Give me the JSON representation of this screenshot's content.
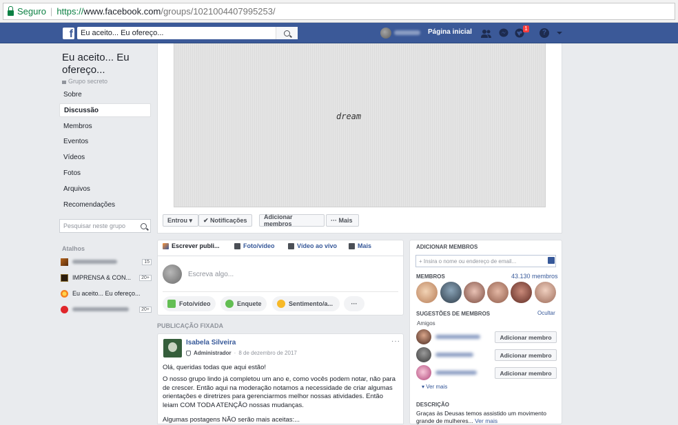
{
  "browser": {
    "secure_label": "Seguro",
    "url_prefix": "https://",
    "url_domain": "www.facebook.com",
    "url_path": "/groups/1021004407995253/"
  },
  "topbar": {
    "logo": "f",
    "search_value": "Eu aceito... Eu ofereço...",
    "home_label": "Página inicial",
    "notification_count": "1",
    "help": "?"
  },
  "sidebar": {
    "group_name": "Eu aceito... Eu ofereço...",
    "group_type": "Grupo secreto",
    "items": [
      "Sobre",
      "Discussão",
      "Membros",
      "Eventos",
      "Vídeos",
      "Fotos",
      "Arquivos",
      "Recomendações"
    ],
    "active_index": 1,
    "search_placeholder": "Pesquisar neste grupo",
    "shortcuts_title": "Atalhos",
    "shortcuts": [
      {
        "label": "",
        "count": "15"
      },
      {
        "label": "IMPRENSA & CON...",
        "count": "20+"
      },
      {
        "label": "Eu aceito... Eu ofereço...",
        "count": ""
      },
      {
        "label": "",
        "count": "20+"
      }
    ]
  },
  "cover": {
    "text": "dream",
    "buttons": [
      "Entrou ▾",
      "✔ Notificações",
      "Adicionar membros",
      "··· Mais"
    ]
  },
  "composer": {
    "tabs": [
      "Escrever publi...",
      "Foto/vídeo",
      "Vídeo ao vivo",
      "Mais"
    ],
    "placeholder": "Escreva algo...",
    "actions": [
      "Foto/vídeo",
      "Enquete",
      "Sentimento/a...",
      "···"
    ]
  },
  "pinned": {
    "label": "PUBLICAÇÃO FIXADA",
    "author": "Isabela Silveira",
    "role": "Administrador",
    "date": "8 de dezembro de 2017",
    "menu": "···",
    "paragraphs": [
      "Olá, queridas todas que aqui estão!",
      "O nosso grupo lindo já completou um ano e, como vocês podem notar, não para de crescer. Então aqui na moderação notamos a necessidade de criar algumas orientações e diretrizes para gerenciarmos melhor nossas atividades. Então leiam COM TODA ATENÇÃO nossas mudanças.",
      "Algumas postagens NÃO serão mais aceitas:..."
    ]
  },
  "right": {
    "add_members_title": "ADICIONAR MEMBROS",
    "add_members_placeholder": "+ Insira o nome ou endereço de email...",
    "members_title": "MEMBROS",
    "members_count": "43.130 membros",
    "suggestions_title": "SUGESTÕES DE MEMBROS",
    "hide": "Ocultar",
    "friends": "Amigos",
    "add_member_button": "Adicionar membro",
    "see_more": "Ver mais",
    "description_title": "DESCRIÇÃO",
    "description_text": "Graças às Deusas temos assistido um movimento grande de mulheres...",
    "description_more": "Ver mais"
  },
  "colors": {
    "facebook_blue": "#3b5998",
    "link_blue": "#365899",
    "page_bg": "#e9ebee",
    "secure_green": "#0b8043"
  }
}
